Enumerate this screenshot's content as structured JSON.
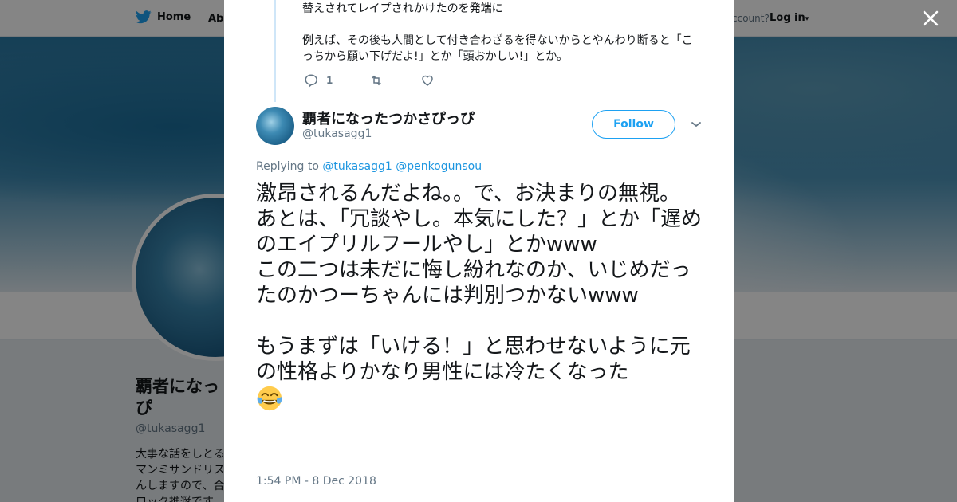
{
  "nav": {
    "home_label": "Home",
    "about_label": "Abo",
    "account_text": "ccount?",
    "login_label": "Log in"
  },
  "background_profile": {
    "name": "覇者になっ\nぴ",
    "handle": "@tukasagg1",
    "bio": "大事な話をしとる\nマンミサンドリス\nんしますので、合\nロック推奨です。"
  },
  "previous_tweet": {
    "text": "替えされてレイプされかけたのを発端に\n\n例えば、その後も人間として付き合わざるを得ないからとやんわり断ると「こっちから願い下げだよ!」とか「頭おかしい!」とか。",
    "reply_count": "1"
  },
  "tweet": {
    "author_name": "覇者になったつかさぴっぴ",
    "author_handle": "@tukasagg1",
    "follow_label": "Follow",
    "replying_prefix": "Replying to",
    "replying_to": [
      "@tukasagg1",
      "@penkogunsou"
    ],
    "text": "激昂されるんだよね。。で、お決まりの無視。\nあとは、「冗談やし。本気にした？」とか「遅めのエイプリルフールやし」とかwww\nこの二つは未だに悔し紛れなのか、いじめだったのかつーちゃんには判別つかないwww\n\nもうまずは「いける！」と思わせないように元の性格よりかなり男性には冷たくなった",
    "emoji": "tears-of-joy",
    "timestamp": "1:54 PM - 8 Dec 2018"
  },
  "colors": {
    "accent": "#1da1f2",
    "mention": "#1b95e0",
    "text": "#14171a",
    "muted": "#657786"
  }
}
